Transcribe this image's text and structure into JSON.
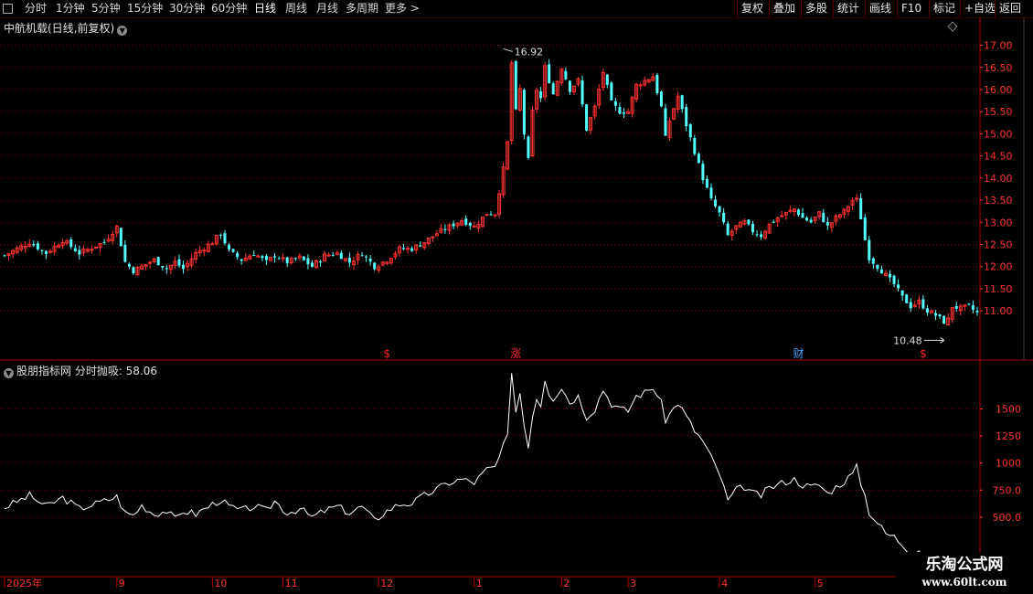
{
  "toolbar": {
    "periods": [
      "分时",
      "1分钟",
      "5分钟",
      "15分钟",
      "30分钟",
      "60分钟",
      "日线",
      "周线",
      "月线",
      "多周期",
      "更多 >"
    ],
    "active_period": "日线",
    "right_buttons": [
      "复权",
      "叠加",
      "多股",
      "统计",
      "画线",
      "F10",
      "标记",
      "+自选",
      "返回"
    ]
  },
  "main_pane": {
    "title": "中航机载(日线,前复权)"
  },
  "indicator_pane": {
    "title": "股朋指标网 分时抛吸: 58.06"
  },
  "watermark": {
    "line1": "乐淘公式网",
    "line2": "www.60lt.com"
  },
  "colors": {
    "up": "#ff3232",
    "down": "#54ffff",
    "grid": "#8a0000",
    "axis": "#b00000",
    "line": "#ffffff",
    "marker": "#ff2020",
    "marker_blue": "#4aa8ff"
  },
  "chart_data": [
    {
      "type": "candlestick",
      "title": "中航机载(日线,前复权)",
      "y_ticks": [
        11.0,
        11.5,
        12.0,
        12.5,
        13.0,
        13.5,
        14.0,
        14.5,
        15.0,
        15.5,
        16.0,
        16.5,
        17.0
      ],
      "ylim": [
        10.28,
        17.28
      ],
      "grid": true,
      "annotations": {
        "high": 16.92,
        "low": 10.48
      },
      "event_markers": [
        {
          "label": "$",
          "after_label": "12",
          "color": "red"
        },
        {
          "label": "涨",
          "after_label": "1",
          "color": "red"
        },
        {
          "label": "财",
          "after_label": "4",
          "color": "blue"
        },
        {
          "label": "$",
          "after_label": "5",
          "color": "red"
        }
      ],
      "x_labels": [
        "2025年",
        "9",
        "10",
        "11",
        "12",
        "1",
        "2",
        "3",
        "4",
        "5"
      ],
      "close_path": [
        [
          0,
          12.25
        ],
        [
          6,
          12.55
        ],
        [
          10,
          12.3
        ],
        [
          14,
          12.6
        ],
        [
          18,
          12.3
        ],
        [
          24,
          12.55
        ],
        [
          27,
          12.9
        ],
        [
          29,
          12.1
        ],
        [
          31,
          11.9
        ],
        [
          33,
          12.0
        ],
        [
          36,
          12.15
        ],
        [
          39,
          11.95
        ],
        [
          41,
          12.1
        ],
        [
          43,
          11.95
        ],
        [
          46,
          12.3
        ],
        [
          50,
          12.55
        ],
        [
          52,
          12.75
        ],
        [
          54,
          12.35
        ],
        [
          57,
          12.15
        ],
        [
          60,
          12.3
        ],
        [
          63,
          12.1
        ],
        [
          65,
          12.25
        ],
        [
          68,
          12.1
        ],
        [
          71,
          12.2
        ],
        [
          74,
          12.0
        ],
        [
          77,
          12.25
        ],
        [
          80,
          12.3
        ],
        [
          83,
          12.1
        ],
        [
          86,
          12.3
        ],
        [
          89,
          12.0
        ],
        [
          92,
          12.15
        ],
        [
          95,
          12.4
        ],
        [
          98,
          12.4
        ],
        [
          101,
          12.55
        ],
        [
          104,
          12.75
        ],
        [
          107,
          12.9
        ],
        [
          110,
          13.05
        ],
        [
          113,
          12.9
        ],
        [
          116,
          13.2
        ],
        [
          118,
          13.2
        ],
        [
          120,
          14.2
        ],
        [
          121,
          14.8
        ],
        [
          122,
          16.6
        ],
        [
          123,
          15.5
        ],
        [
          124,
          16.0
        ],
        [
          125,
          15.0
        ],
        [
          126,
          14.4
        ],
        [
          127,
          15.5
        ],
        [
          128,
          16.0
        ],
        [
          129,
          15.8
        ],
        [
          130,
          16.5
        ],
        [
          131,
          16.2
        ],
        [
          132,
          15.9
        ],
        [
          134,
          16.5
        ],
        [
          136,
          16.0
        ],
        [
          138,
          16.2
        ],
        [
          140,
          15.1
        ],
        [
          142,
          15.6
        ],
        [
          144,
          16.4
        ],
        [
          146,
          15.7
        ],
        [
          148,
          15.5
        ],
        [
          150,
          15.5
        ],
        [
          152,
          16.1
        ],
        [
          154,
          16.2
        ],
        [
          156,
          16.3
        ],
        [
          158,
          15.6
        ],
        [
          159,
          14.9
        ],
        [
          160,
          15.3
        ],
        [
          162,
          15.85
        ],
        [
          164,
          15.2
        ],
        [
          166,
          14.6
        ],
        [
          168,
          14.0
        ],
        [
          170,
          13.5
        ],
        [
          172,
          13.2
        ],
        [
          174,
          12.7
        ],
        [
          176,
          12.9
        ],
        [
          178,
          13.0
        ],
        [
          180,
          12.8
        ],
        [
          182,
          12.7
        ],
        [
          184,
          12.95
        ],
        [
          186,
          13.1
        ],
        [
          188,
          13.2
        ],
        [
          190,
          13.3
        ],
        [
          192,
          13.1
        ],
        [
          194,
          13.0
        ],
        [
          196,
          13.2
        ],
        [
          198,
          12.9
        ],
        [
          200,
          13.1
        ],
        [
          202,
          13.25
        ],
        [
          204,
          13.5
        ],
        [
          205,
          13.5
        ],
        [
          206,
          13.1
        ],
        [
          207,
          12.6
        ],
        [
          208,
          12.2
        ],
        [
          210,
          12.0
        ],
        [
          212,
          11.8
        ],
        [
          214,
          11.6
        ],
        [
          216,
          11.3
        ],
        [
          218,
          11.1
        ],
        [
          220,
          11.2
        ],
        [
          222,
          11.0
        ],
        [
          224,
          10.9
        ],
        [
          226,
          10.75
        ],
        [
          227,
          10.8
        ],
        [
          228,
          11.1
        ],
        [
          230,
          11.05
        ],
        [
          232,
          11.1
        ],
        [
          234,
          10.95
        ]
      ]
    },
    {
      "type": "line",
      "series": [
        {
          "name": "分时抛吸",
          "last_value": 58.06
        }
      ],
      "y_ticks": [
        500.0,
        750.0,
        1000,
        1250,
        1500
      ],
      "ylim": [
        -40,
        1900
      ],
      "grid": true,
      "path": [
        [
          0,
          590
        ],
        [
          6,
          700
        ],
        [
          10,
          600
        ],
        [
          14,
          680
        ],
        [
          18,
          580
        ],
        [
          24,
          650
        ],
        [
          27,
          690
        ],
        [
          29,
          540
        ],
        [
          31,
          520
        ],
        [
          33,
          610
        ],
        [
          36,
          530
        ],
        [
          39,
          560
        ],
        [
          41,
          480
        ],
        [
          43,
          560
        ],
        [
          46,
          530
        ],
        [
          50,
          620
        ],
        [
          52,
          660
        ],
        [
          54,
          600
        ],
        [
          57,
          560
        ],
        [
          60,
          600
        ],
        [
          63,
          560
        ],
        [
          65,
          650
        ],
        [
          68,
          540
        ],
        [
          71,
          580
        ],
        [
          74,
          500
        ],
        [
          77,
          560
        ],
        [
          80,
          600
        ],
        [
          83,
          540
        ],
        [
          86,
          600
        ],
        [
          89,
          470
        ],
        [
          92,
          560
        ],
        [
          95,
          620
        ],
        [
          98,
          630
        ],
        [
          101,
          700
        ],
        [
          104,
          760
        ],
        [
          107,
          820
        ],
        [
          110,
          850
        ],
        [
          113,
          820
        ],
        [
          116,
          940
        ],
        [
          118,
          960
        ],
        [
          120,
          1150
        ],
        [
          121,
          1250
        ],
        [
          122,
          1800
        ],
        [
          123,
          1500
        ],
        [
          124,
          1650
        ],
        [
          125,
          1350
        ],
        [
          126,
          1150
        ],
        [
          127,
          1450
        ],
        [
          128,
          1600
        ],
        [
          129,
          1540
        ],
        [
          130,
          1780
        ],
        [
          131,
          1650
        ],
        [
          132,
          1600
        ],
        [
          134,
          1700
        ],
        [
          136,
          1560
        ],
        [
          138,
          1620
        ],
        [
          140,
          1430
        ],
        [
          142,
          1500
        ],
        [
          144,
          1680
        ],
        [
          146,
          1550
        ],
        [
          148,
          1500
        ],
        [
          150,
          1480
        ],
        [
          152,
          1620
        ],
        [
          154,
          1650
        ],
        [
          156,
          1700
        ],
        [
          158,
          1550
        ],
        [
          159,
          1400
        ],
        [
          160,
          1450
        ],
        [
          162,
          1560
        ],
        [
          164,
          1430
        ],
        [
          166,
          1300
        ],
        [
          168,
          1200
        ],
        [
          170,
          1050
        ],
        [
          172,
          900
        ],
        [
          174,
          650
        ],
        [
          176,
          750
        ],
        [
          178,
          780
        ],
        [
          180,
          720
        ],
        [
          182,
          700
        ],
        [
          184,
          770
        ],
        [
          186,
          800
        ],
        [
          188,
          830
        ],
        [
          190,
          850
        ],
        [
          192,
          800
        ],
        [
          194,
          780
        ],
        [
          196,
          800
        ],
        [
          198,
          720
        ],
        [
          200,
          780
        ],
        [
          202,
          830
        ],
        [
          204,
          900
        ],
        [
          205,
          960
        ],
        [
          206,
          820
        ],
        [
          207,
          700
        ],
        [
          208,
          550
        ],
        [
          210,
          450
        ],
        [
          212,
          350
        ],
        [
          214,
          320
        ],
        [
          216,
          250
        ],
        [
          218,
          180
        ],
        [
          220,
          200
        ],
        [
          222,
          110
        ],
        [
          224,
          40
        ],
        [
          226,
          -10
        ],
        [
          227,
          20
        ],
        [
          228,
          120
        ],
        [
          230,
          80
        ],
        [
          232,
          100
        ],
        [
          234,
          58.06
        ]
      ]
    }
  ]
}
